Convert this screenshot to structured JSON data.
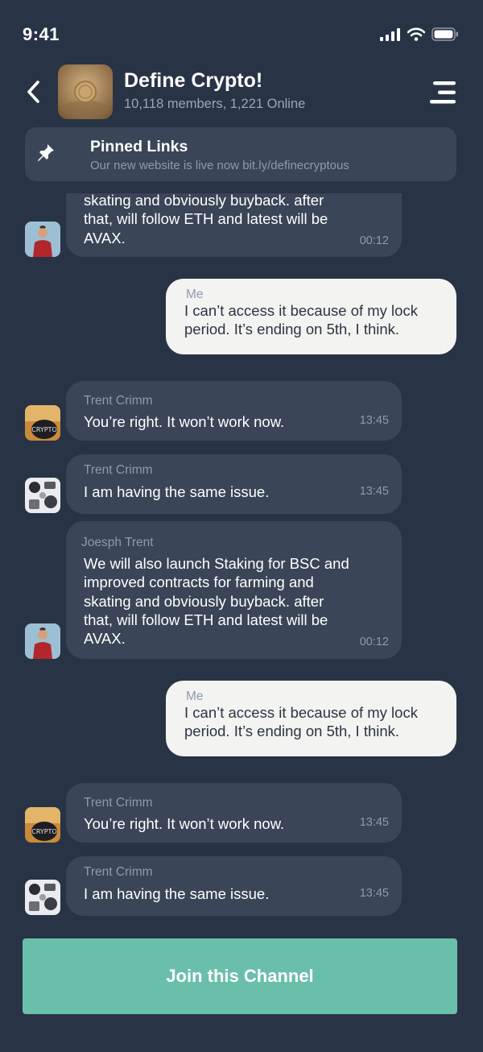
{
  "status_bar": {
    "time": "9:41"
  },
  "header": {
    "title": "Define Crypto!",
    "subtitle": "10,118 members, 1,221 Online"
  },
  "pinned": {
    "title": "Pinned Links",
    "text": "Our new website is live now bit.ly/definecryptous"
  },
  "messages": [
    {
      "sender": "",
      "text": "skating and obviously buyback. after\nthat, will follow ETH and latest will be\nAVAX.",
      "time": "00:12",
      "direction": "in"
    },
    {
      "sender": "Me",
      "text": "I can’t access it because of my lock\nperiod. It’s ending on 5th, I think.",
      "time": "",
      "direction": "out"
    },
    {
      "sender": "Trent Crimm",
      "text": "You’re right. It won’t work now.",
      "time": "13:45",
      "direction": "in"
    },
    {
      "sender": "Trent Crimm",
      "text": "I am having the same issue.",
      "time": "13:45",
      "direction": "in"
    },
    {
      "sender": "Joesph Trent",
      "text": "We will also launch Staking for BSC and\nimproved contracts for farming and\nskating and obviously buyback. after\nthat, will follow ETH and latest will be\nAVAX.",
      "time": "00:12",
      "direction": "in"
    },
    {
      "sender": "Me",
      "text": "I can’t access it because of my lock\nperiod. It’s ending on 5th, I think.",
      "time": "",
      "direction": "out"
    },
    {
      "sender": "Trent Crimm",
      "text": "You’re right. It won’t work now.",
      "time": "13:45",
      "direction": "in"
    },
    {
      "sender": "Trent Crimm",
      "text": "I am having the same issue.",
      "time": "13:45",
      "direction": "in"
    }
  ],
  "join_button": {
    "label": "Join this Channel"
  },
  "colors": {
    "background": "#283346",
    "bubble_in": "#3a4557",
    "bubble_out": "#f3f3f1",
    "accent": "#6abfab"
  }
}
